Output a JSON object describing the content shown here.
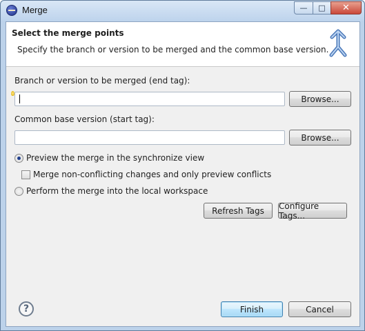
{
  "window": {
    "title": "Merge",
    "controls": {
      "minimize": "—",
      "maximize": "□",
      "close": "✕"
    }
  },
  "header": {
    "title": "Select the merge points",
    "description": "Specify the branch or version to be merged and the common base version.",
    "icon": "merge-arrow-icon"
  },
  "form": {
    "branch_label": "Branch or version to be merged (end tag):",
    "branch_value": "",
    "branch_browse": "Browse...",
    "base_label": "Common base version (start tag):",
    "base_value": "",
    "base_browse": "Browse..."
  },
  "options": {
    "preview_label": "Preview the merge in the synchronize view",
    "preview_checked": true,
    "nonconflicting_label": "Merge non-conflicting changes and only preview conflicts",
    "nonconflicting_checked": false,
    "perform_label": "Perform the merge into the local workspace",
    "perform_checked": false
  },
  "tags": {
    "refresh": "Refresh Tags",
    "configure": "Configure Tags..."
  },
  "footer": {
    "help": "?",
    "finish": "Finish",
    "cancel": "Cancel"
  },
  "colors": {
    "accent": "#3c7fb1",
    "frame": "#bcd2ea"
  }
}
